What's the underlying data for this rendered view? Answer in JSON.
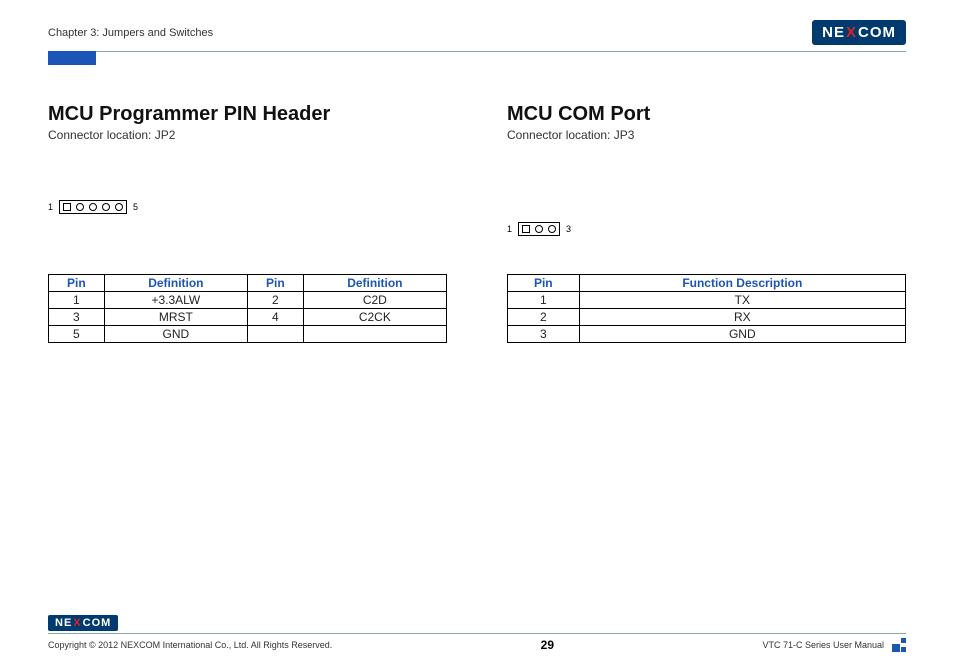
{
  "header": {
    "chapter": "Chapter 3: Jumpers and Switches",
    "logo_text_left": "NE",
    "logo_text_x": "X",
    "logo_text_right": "COM"
  },
  "left": {
    "title": "MCU Programmer PIN Header",
    "sub": "Connector location: JP2",
    "diagram": {
      "left_label": "1",
      "right_label": "5"
    },
    "table": {
      "headers": [
        "Pin",
        "Definition",
        "Pin",
        "Definition"
      ],
      "rows": [
        [
          "1",
          "+3.3ALW",
          "2",
          "C2D"
        ],
        [
          "3",
          "MRST",
          "4",
          "C2CK"
        ],
        [
          "5",
          "GND",
          "",
          ""
        ]
      ]
    }
  },
  "right": {
    "title": "MCU COM Port",
    "sub": "Connector location: JP3",
    "diagram": {
      "left_label": "1",
      "right_label": "3"
    },
    "table": {
      "headers": [
        "Pin",
        "Function Description"
      ],
      "rows": [
        [
          "1",
          "TX"
        ],
        [
          "2",
          "RX"
        ],
        [
          "3",
          "GND"
        ]
      ]
    }
  },
  "footer": {
    "copyright": "Copyright © 2012 NEXCOM International Co., Ltd. All Rights Reserved.",
    "page": "29",
    "manual": "VTC 71-C Series User Manual"
  }
}
